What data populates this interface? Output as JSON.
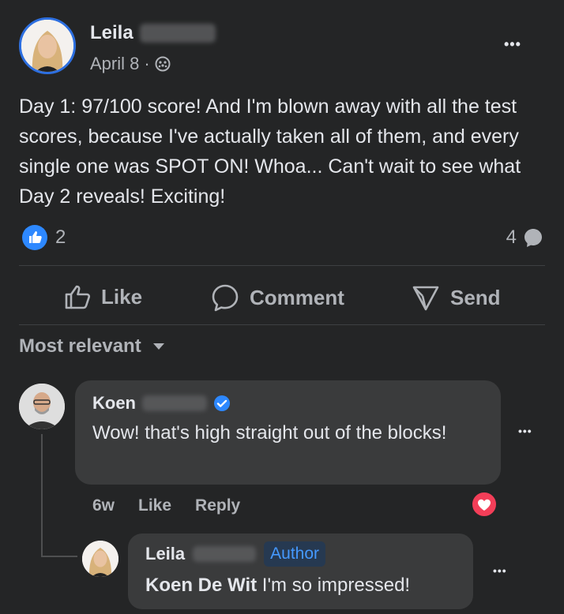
{
  "post": {
    "author_first": "Leila",
    "date": "April 8",
    "separator": "·",
    "body": "Day 1: 97/100 score! And I'm blown away with all the test scores, because I've actually taken all of them, and every single one was SPOT ON! Whoa... Can't wait to see what Day 2 reveals! Exciting!",
    "like_count": "2",
    "comment_count": "4",
    "more_icon": "•••"
  },
  "actions": {
    "like": "Like",
    "comment": "Comment",
    "send": "Send"
  },
  "sort": {
    "label": "Most relevant"
  },
  "comments": [
    {
      "author_first": "Koen",
      "text": "Wow! that's high straight out of the blocks!",
      "time": "6w",
      "like": "Like",
      "reply": "Reply",
      "more_icon": "•••"
    }
  ],
  "reply": {
    "author_first": "Leila",
    "badge": "Author",
    "mention": "Koen De Wit",
    "text": "I'm so impressed!",
    "more_icon": "•••"
  },
  "colors": {
    "accent_blue": "#2d88ff",
    "badge_text": "#4599ff",
    "heart_red": "#f33e58"
  }
}
